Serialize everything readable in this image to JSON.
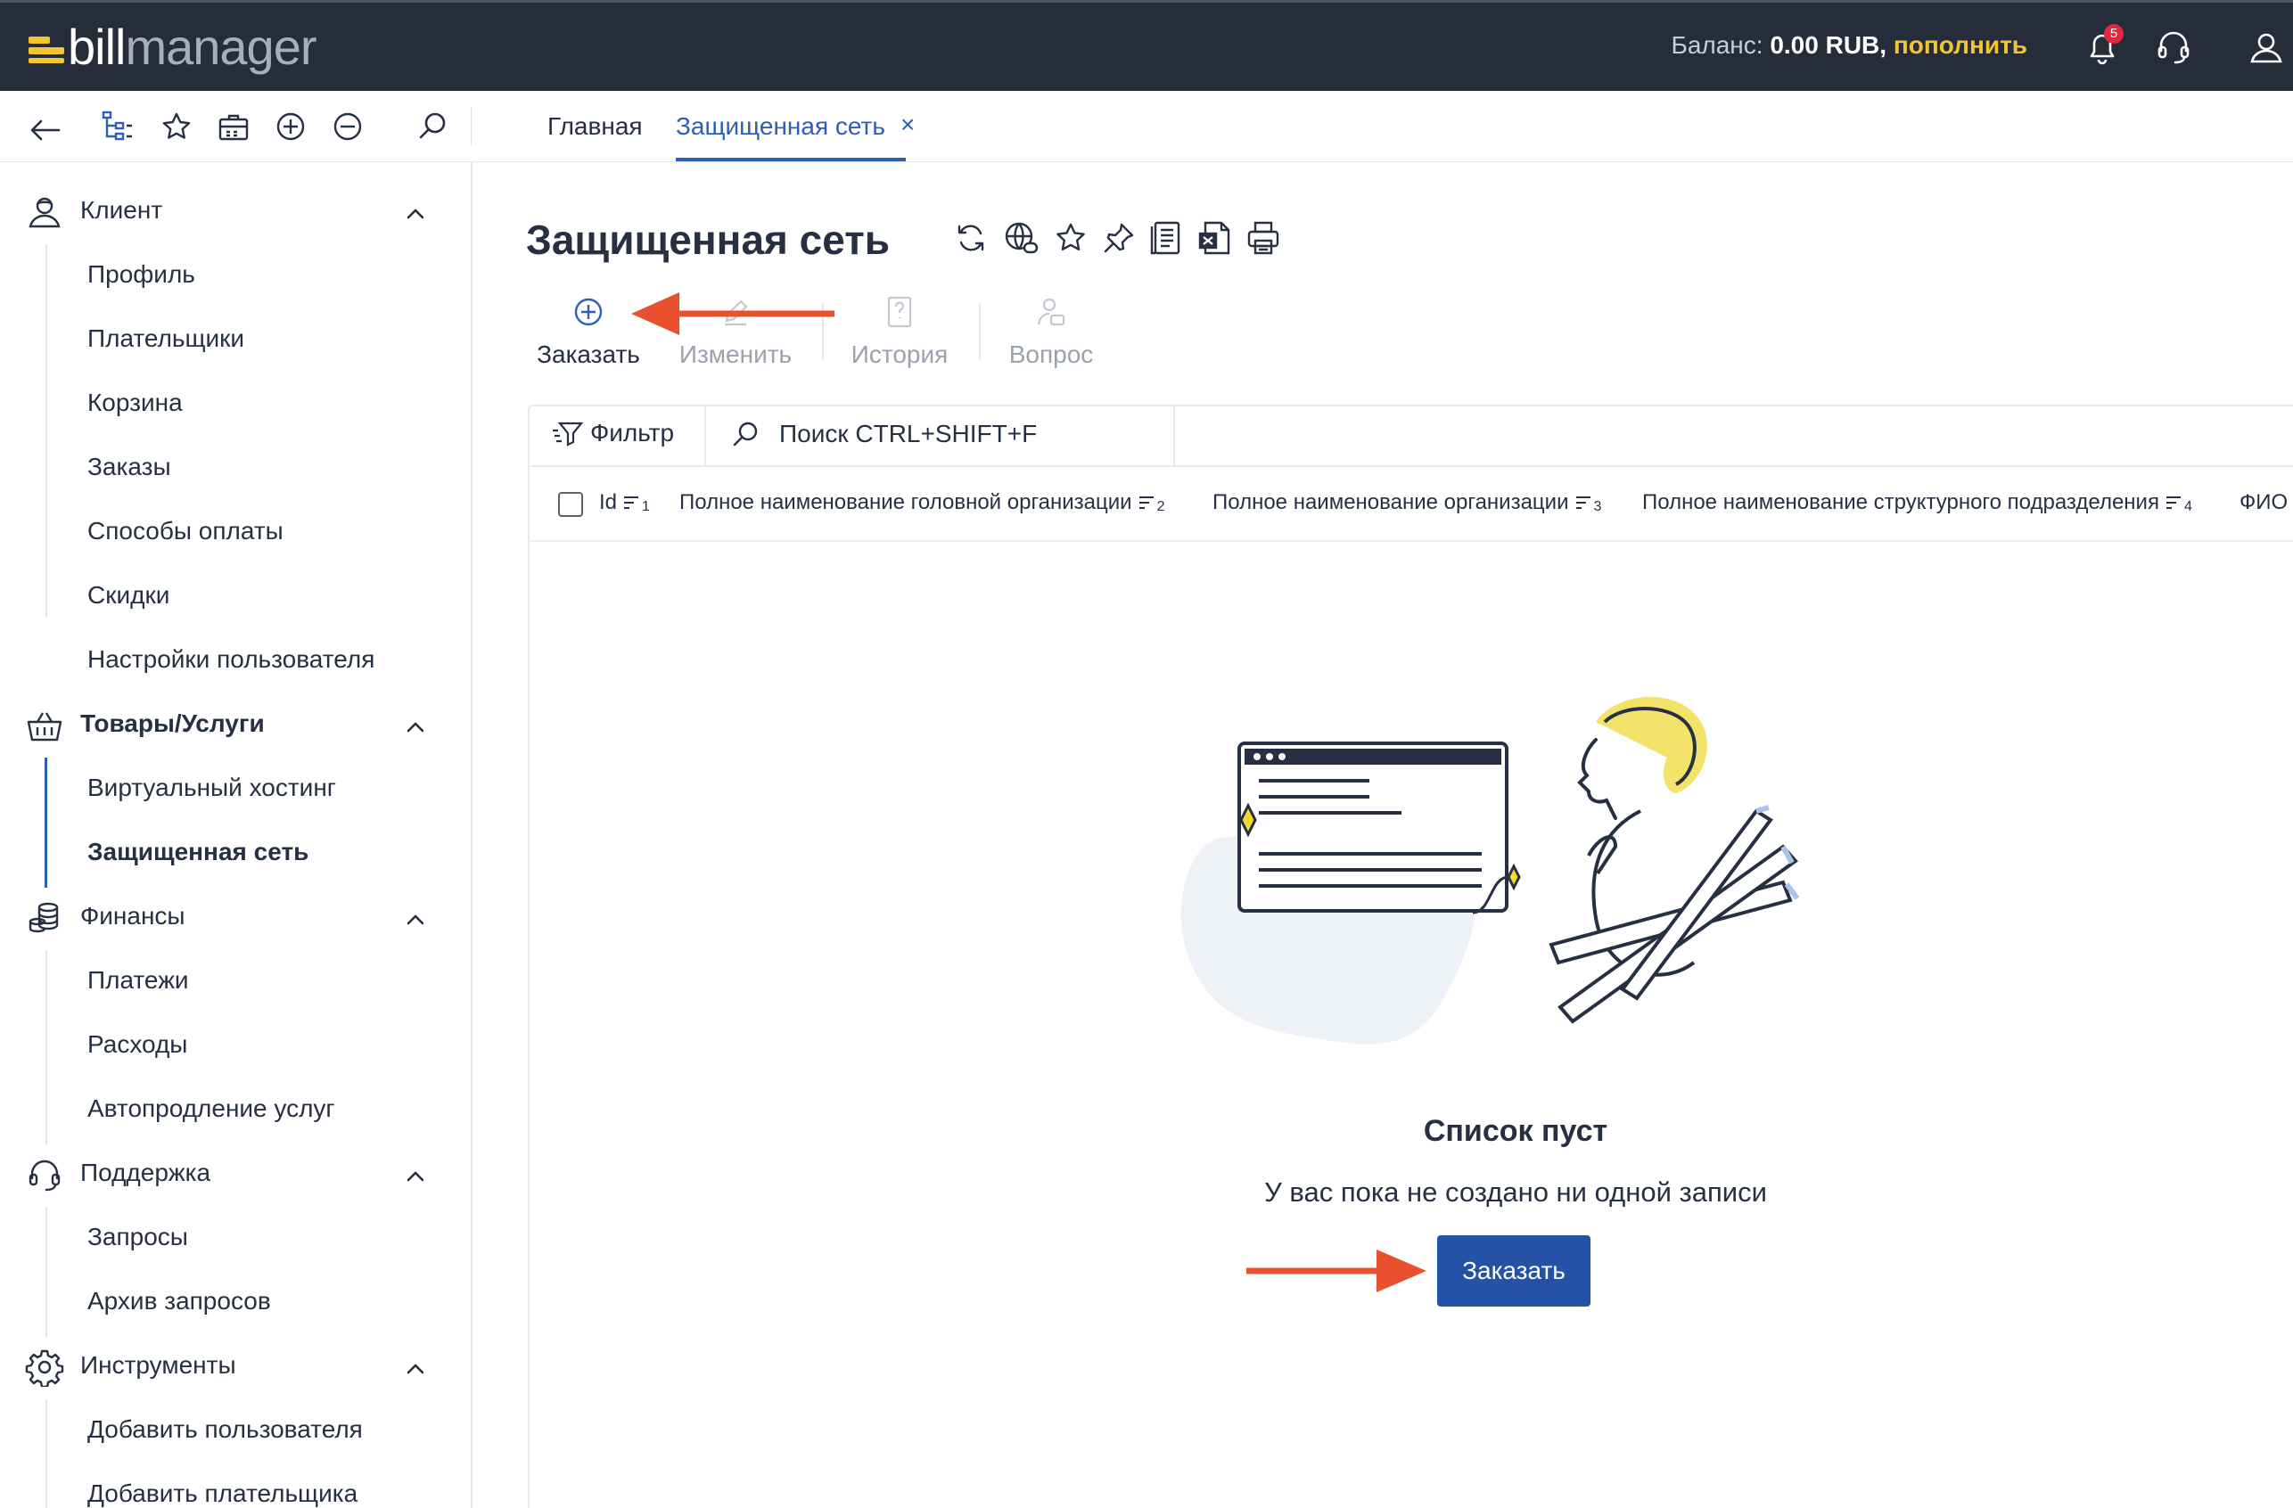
{
  "brand": {
    "part1": "bill",
    "part2": "manager"
  },
  "header": {
    "balance_label": "Баланс:",
    "balance_value": "0.00 RUB,",
    "topup_label": "пополнить",
    "notifications_count": "5"
  },
  "tabs": [
    {
      "label": "Главная"
    },
    {
      "label": "Защищенная сеть",
      "close": "×"
    }
  ],
  "sidebar": {
    "groups": [
      {
        "label": "Клиент",
        "items": [
          "Профиль",
          "Плательщики",
          "Корзина",
          "Заказы",
          "Способы оплаты",
          "Скидки",
          "Настройки пользователя"
        ]
      },
      {
        "label": "Товары/Услуги",
        "items": [
          "Виртуальный хостинг",
          "Защищенная сеть"
        ]
      },
      {
        "label": "Финансы",
        "items": [
          "Платежи",
          "Расходы",
          "Автопродление услуг"
        ]
      },
      {
        "label": "Поддержка",
        "items": [
          "Запросы",
          "Архив запросов"
        ]
      },
      {
        "label": "Инструменты",
        "items": [
          "Добавить пользователя",
          "Добавить плательщика"
        ]
      }
    ],
    "active_item": "Защищенная сеть"
  },
  "page": {
    "title": "Защищенная сеть",
    "actions": [
      {
        "label": "Заказать",
        "enabled": true
      },
      {
        "label": "Изменить",
        "enabled": false
      },
      {
        "label": "История",
        "enabled": false
      },
      {
        "label": "Вопрос",
        "enabled": false
      }
    ],
    "filter_label": "Фильтр",
    "search_placeholder": "Поиск CTRL+SHIFT+F",
    "columns": [
      {
        "label": "Id",
        "sort": "1"
      },
      {
        "label": "Полное наименование головной организации",
        "sort": "2"
      },
      {
        "label": "Полное наименование организации",
        "sort": "3"
      },
      {
        "label": "Полное наименование структурного подразделения",
        "sort": "4"
      },
      {
        "label": "ФИО"
      }
    ],
    "empty": {
      "title": "Список пуст",
      "subtitle": "У вас пока не создано ни одной записи",
      "button": "Заказать"
    }
  },
  "colors": {
    "topbar": "#252d3b",
    "accent": "#2d5fb6",
    "brand_yellow": "#f3c531",
    "annotation_arrow": "#e8502e",
    "button": "#2452a7"
  }
}
